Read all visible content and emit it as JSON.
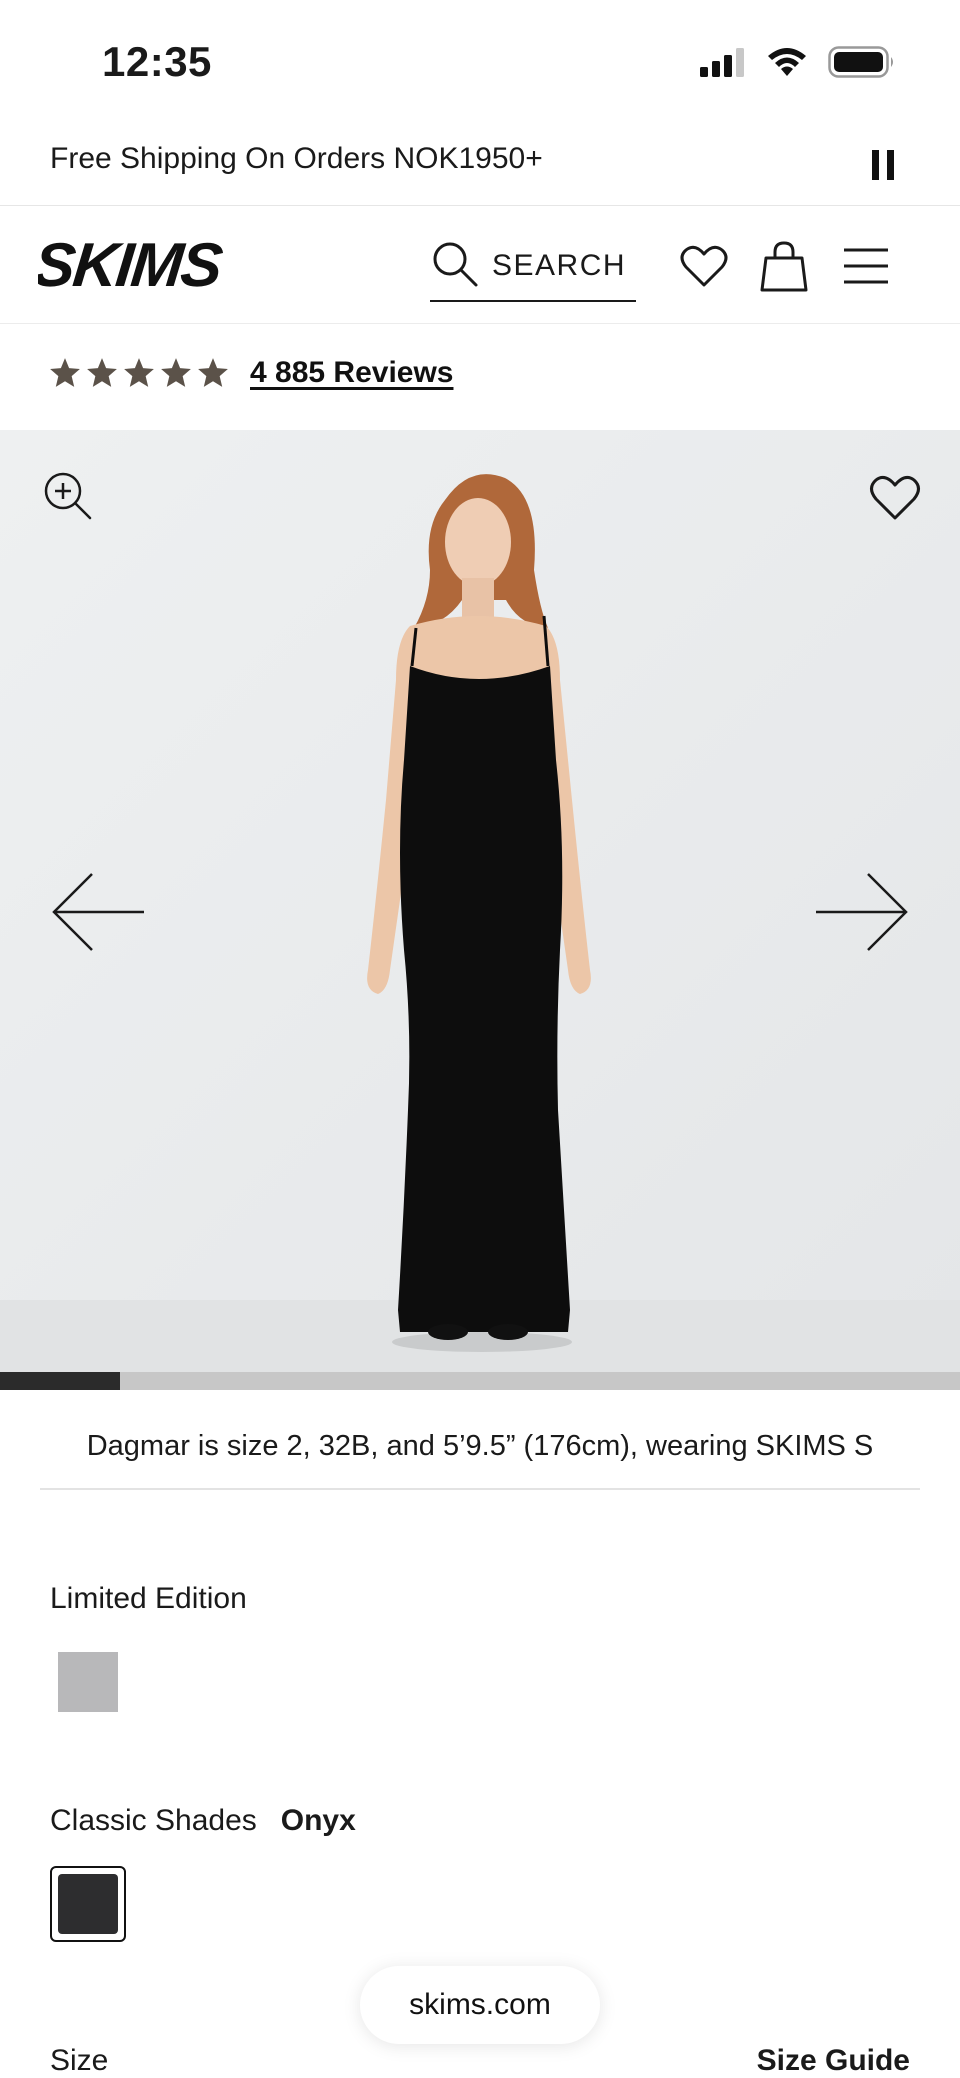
{
  "status_bar": {
    "time": "12:35",
    "icons": [
      "cellular-signal-icon",
      "wifi-icon",
      "battery-icon"
    ]
  },
  "promo": {
    "text": "Free Shipping On Orders NOK1950+",
    "pause_icon": "pause-icon"
  },
  "header": {
    "logo_text": "SKIMS",
    "search_label": "SEARCH",
    "icons": [
      "search-icon",
      "heart-icon",
      "shopping-bag-icon",
      "hamburger-menu-icon"
    ]
  },
  "reviews": {
    "rating": 5,
    "max_rating": 5,
    "link_text": "4 885 Reviews",
    "star_color": "#5b5249"
  },
  "product_image": {
    "description_icons": [
      "zoom-in-icon",
      "heart-icon",
      "arrow-left-icon",
      "arrow-right-icon"
    ],
    "background_color": "#ebedee",
    "dress_color": "#0d0d0d",
    "carousel_progress": 0.125
  },
  "caption": {
    "text": "Dagmar is size 2, 32B, and 5’9.5” (176cm), wearing SKIMS S"
  },
  "options": {
    "limited_edition": {
      "label": "Limited Edition",
      "swatch_color": "#b8b8ba"
    },
    "classic_shades": {
      "label": "Classic Shades",
      "selected": "Onyx",
      "swatch_color": "#2d2d2f"
    }
  },
  "url_bar": {
    "text": "skims.com"
  },
  "size": {
    "label": "Size",
    "guide_label": "Size Guide"
  }
}
